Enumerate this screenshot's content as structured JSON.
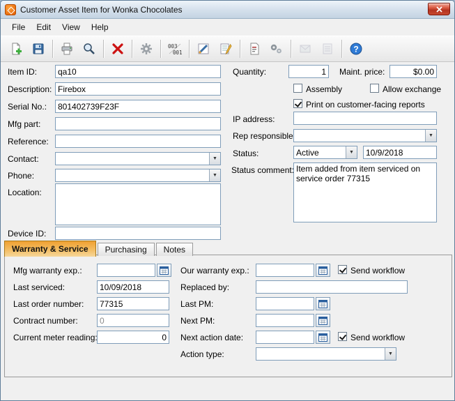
{
  "window": {
    "title": "Customer Asset Item for Wonka Chocolates"
  },
  "menu": {
    "items": [
      "File",
      "Edit",
      "View",
      "Help"
    ]
  },
  "toolbar": {
    "buttons": [
      "new-document",
      "save",
      "print",
      "find",
      "delete",
      "settings",
      "serial-lot-numbers",
      "analysis",
      "journal",
      "note",
      "process",
      "mail",
      "report",
      "help"
    ]
  },
  "form": {
    "item_id": {
      "label": "Item ID:",
      "value": "qa10"
    },
    "description": {
      "label": "Description:",
      "value": "Firebox"
    },
    "serial_no": {
      "label": "Serial No.:",
      "value": "801402739F23F"
    },
    "mfg_part": {
      "label": "Mfg part:",
      "value": ""
    },
    "reference": {
      "label": "Reference:",
      "value": ""
    },
    "contact": {
      "label": "Contact:",
      "value": ""
    },
    "phone": {
      "label": "Phone:",
      "value": ""
    },
    "location": {
      "label": "Location:",
      "value": ""
    },
    "device_id": {
      "label": "Device ID:",
      "value": ""
    },
    "quantity": {
      "label": "Quantity:",
      "value": "1"
    },
    "maint_price": {
      "label": "Maint. price:",
      "value": "$0.00"
    },
    "assembly": {
      "label": "Assembly",
      "checked": false
    },
    "allow_exchange": {
      "label": "Allow exchange",
      "checked": false
    },
    "print_reports": {
      "label": "Print on customer-facing reports",
      "checked": true
    },
    "ip_address": {
      "label": "IP address:",
      "value": ""
    },
    "rep_responsible": {
      "label": "Rep responsible:",
      "value": ""
    },
    "status": {
      "label": "Status:",
      "value": "Active",
      "date": "10/9/2018"
    },
    "status_comment": {
      "label": "Status comment:",
      "value": "Item added from item serviced on service order 77315"
    }
  },
  "tabs": {
    "items": [
      {
        "label": "Warranty & Service"
      },
      {
        "label": "Purchasing"
      },
      {
        "label": "Notes"
      }
    ]
  },
  "warranty": {
    "mfg_warranty_exp": {
      "label": "Mfg warranty exp.:",
      "value": ""
    },
    "last_serviced": {
      "label": "Last serviced:",
      "value": "10/09/2018"
    },
    "last_order_number": {
      "label": "Last order number:",
      "value": "77315"
    },
    "contract_number": {
      "label": "Contract number:",
      "value": "0"
    },
    "current_meter_reading": {
      "label": "Current meter reading:",
      "value": "0"
    },
    "our_warranty_exp": {
      "label": "Our warranty exp.:",
      "value": "",
      "send_workflow": {
        "label": "Send workflow",
        "checked": true
      }
    },
    "replaced_by": {
      "label": "Replaced by:",
      "value": ""
    },
    "last_pm": {
      "label": "Last PM:",
      "value": ""
    },
    "next_pm": {
      "label": "Next PM:",
      "value": ""
    },
    "next_action_date": {
      "label": "Next action date:",
      "value": "",
      "send_workflow": {
        "label": "Send workflow",
        "checked": true
      }
    },
    "action_type": {
      "label": "Action type:",
      "value": ""
    }
  }
}
